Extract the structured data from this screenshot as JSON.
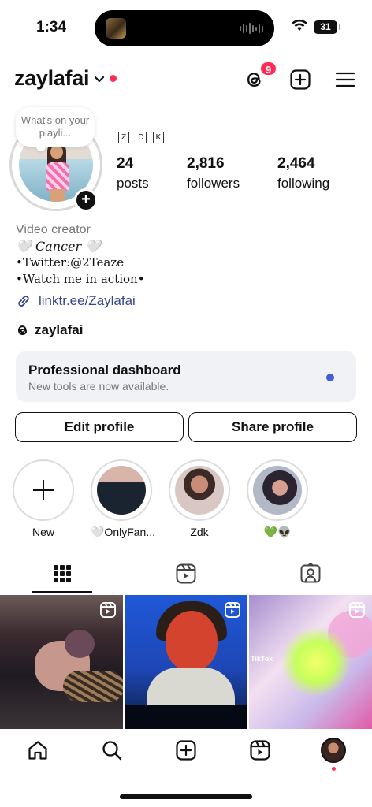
{
  "status_bar": {
    "time": "1:34",
    "battery": "31"
  },
  "header": {
    "username": "zaylafai",
    "notification_count": "9"
  },
  "profile": {
    "note": "What's on your playli...",
    "name_glyphs": [
      "Z",
      "D",
      "K"
    ],
    "stats": [
      {
        "value": "24",
        "label": "posts"
      },
      {
        "value": "2,816",
        "label": "followers"
      },
      {
        "value": "2,464",
        "label": "following"
      }
    ],
    "category": "Video creator",
    "bio_lines": [
      "🤍 𝐶𝑎𝑛𝑐𝑒𝑟 🤍",
      "•Twitter:@2Teaze",
      "•Watch me in action•"
    ],
    "link": "linktr.ee/Zaylafai",
    "threads_handle": "zaylafai"
  },
  "dashboard": {
    "title": "Professional dashboard",
    "subtitle": "New tools are now available."
  },
  "buttons": {
    "edit": "Edit profile",
    "share": "Share profile"
  },
  "highlights": [
    {
      "label": "New"
    },
    {
      "label": "🤍OnlyFan..."
    },
    {
      "label": "Zdk"
    },
    {
      "label": "💚👽"
    }
  ],
  "grid": {
    "tile3_overlay": "TikTok"
  },
  "colors": {
    "accent_red": "#ff2d55",
    "link_blue": "#38468f",
    "dashboard_dot": "#4a5bd6"
  }
}
